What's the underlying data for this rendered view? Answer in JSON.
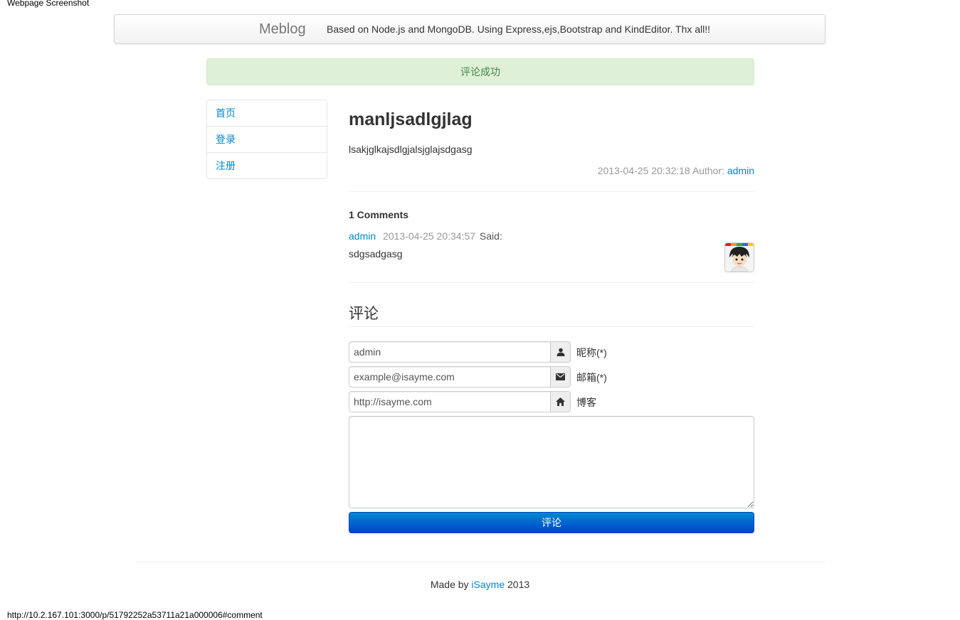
{
  "caption": "Webpage Screenshot",
  "navbar": {
    "brand": "Meblog",
    "description": "Based on Node.js and MongoDB. Using Express,ejs,Bootstrap and KindEditor. Thx all!!"
  },
  "alert": {
    "message": "评论成功",
    "color": "#dff0d8"
  },
  "sidebar": {
    "items": [
      {
        "label": "首页"
      },
      {
        "label": "登录"
      },
      {
        "label": "注册"
      }
    ]
  },
  "post": {
    "title": "manljsadlgjlag",
    "body": "lsakjglkajsdlgjalsjglajsdgasg",
    "timestamp": "2013-04-25 20:32:18",
    "author_label": "Author:",
    "author": "admin"
  },
  "comments": {
    "count_label": "1 Comments",
    "items": [
      {
        "author": "admin",
        "time": "2013-04-25 20:34:57",
        "said": "Said:",
        "text": "sdgsadgasg",
        "avatar_icon": "user-avatar-icon"
      }
    ]
  },
  "comment_form": {
    "title": "评论",
    "nickname": {
      "value": "admin",
      "label": "昵称(*)",
      "icon": "user-icon"
    },
    "email": {
      "value": "example@isayme.com",
      "label": "邮箱(*)",
      "icon": "envelope-icon"
    },
    "blog": {
      "value": "http://isayme.com",
      "label": "博客",
      "icon": "home-icon"
    },
    "message": {
      "value": ""
    },
    "submit_label": "评论",
    "button_color": "#0066cc"
  },
  "footer": {
    "prefix": "Made by",
    "link": "iSayme",
    "year": "2013"
  },
  "status_bar": {
    "url": "http://10.2.167.101:3000/p/51792252a53711a21a000006#comment"
  }
}
